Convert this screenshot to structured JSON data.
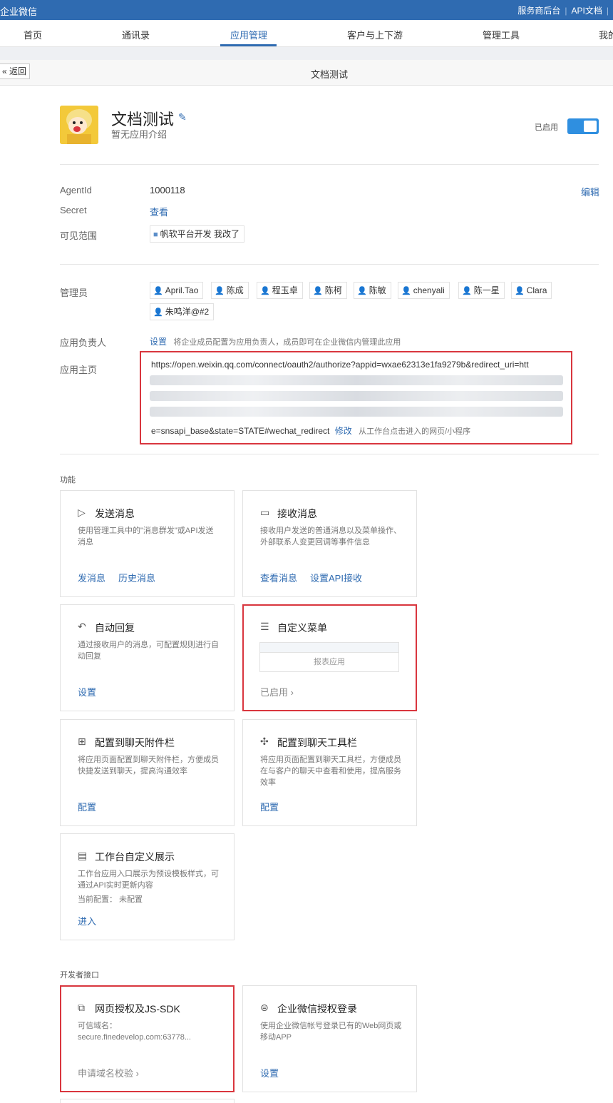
{
  "topbar": {
    "brand": "企业微信",
    "links": [
      "服务商后台",
      "API文档"
    ]
  },
  "nav": {
    "items": [
      "首页",
      "通讯录",
      "应用管理",
      "客户与上下游",
      "管理工具",
      "我的"
    ],
    "active_index": 2
  },
  "subbar": {
    "back_label": "« 返回",
    "title": "文档测试"
  },
  "app": {
    "name": "文档测试",
    "description": "暂无应用介绍",
    "status_label": "已启用",
    "enabled": true
  },
  "info": {
    "agentid_label": "AgentId",
    "agentid_value": "1000118",
    "edit_label": "编辑",
    "secret_label": "Secret",
    "secret_value": "查看",
    "scope_label": "可见范围",
    "scope_value": "帆软平台开发 我改了"
  },
  "admins": {
    "label": "管理员",
    "users": [
      "April.Tao",
      "陈成",
      "程玉卓",
      "陈柯",
      "陈敏",
      "chenyali",
      "陈一星",
      "Clara",
      "朱鸣洋@#2"
    ]
  },
  "owner": {
    "label": "应用负责人",
    "action": "设置",
    "hint": "将企业成员配置为应用负责人，成员即可在企业微信内管理此应用"
  },
  "homepage": {
    "label": "应用主页",
    "url_line1": "https://open.weixin.qq.com/connect/oauth2/authorize?appid=wxae62313e1fa9279b&redirect_uri=htt",
    "url_last": "e=snsapi_base&state=STATE#wechat_redirect",
    "modify": "修改",
    "hint": "从工作台点击进入的网页/小程序"
  },
  "functions": {
    "section_label": "功能",
    "cards": [
      {
        "icon": "send-icon",
        "title": "发送消息",
        "desc": "使用管理工具中的\"消息群发\"或API发送消息",
        "actions": [
          "发消息",
          "历史消息"
        ]
      },
      {
        "icon": "message-icon",
        "title": "接收消息",
        "desc": "接收用户发送的普通消息以及菜单操作、外部联系人变更回调等事件信息",
        "actions": [
          "查看消息",
          "设置API接收"
        ]
      },
      {
        "icon": "reply-icon",
        "title": "自动回复",
        "desc": "通过接收用户的消息，可配置规则进行自动回复",
        "actions": [
          "设置"
        ]
      },
      {
        "icon": "menu-icon",
        "title": "自定义菜单",
        "preview_label": "报表应用",
        "status": "已启用 ›"
      },
      {
        "icon": "attachment-icon",
        "title": "配置到聊天附件栏",
        "desc": "将应用页面配置到聊天附件栏，方便成员快捷发送到聊天，提高沟通效率",
        "actions": [
          "配置"
        ]
      },
      {
        "icon": "toolbar-icon",
        "title": "配置到聊天工具栏",
        "desc": "将应用页面配置到聊天工具栏，方便成员在与客户的聊天中查看和使用，提高服务效率",
        "actions": [
          "配置"
        ]
      },
      {
        "icon": "workbench-icon",
        "title": "工作台自定义展示",
        "desc": "工作台应用入口展示为预设模板样式，可通过API实时更新内容",
        "config": "当前配置：  未配置",
        "actions": [
          "进入"
        ]
      }
    ]
  },
  "developer": {
    "section_label": "开发者接口",
    "cards": [
      {
        "icon": "web-auth-icon",
        "title": "网页授权及JS-SDK",
        "desc": "可信域名：secure.finedevelop.com:63778...",
        "action": "申请域名校验 ›"
      },
      {
        "icon": "login-icon",
        "title": "企业微信授权登录",
        "desc": "使用企业微信帐号登录已有的Web网页或移动APP",
        "action": "设置"
      }
    ]
  }
}
